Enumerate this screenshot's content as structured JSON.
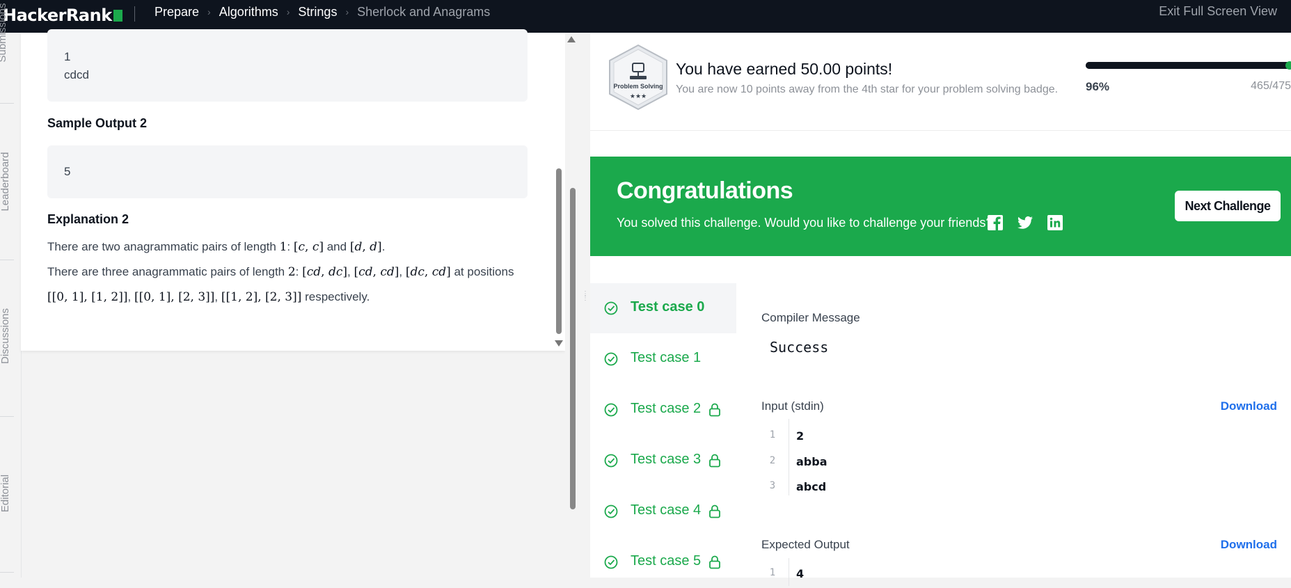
{
  "nav": {
    "logo": "HackerRank",
    "breadcrumbs": [
      "Prepare",
      "Algorithms",
      "Strings",
      "Sherlock and Anagrams"
    ],
    "exit_fullscreen": "Exit Full Screen View"
  },
  "side_tabs": [
    "Submissions",
    "Leaderboard",
    "Discussions",
    "Editorial"
  ],
  "problem": {
    "sample_input_lines": [
      "1",
      "cdcd"
    ],
    "sample_output_heading": "Sample Output 2",
    "sample_output_value": "5",
    "explanation_heading": "Explanation 2",
    "expl_line1_a": "There are two anagrammatic pairs of length ",
    "expl_line1_b": " and ",
    "expl_line1_c": ".",
    "expl_line2_a": "There are three anagrammatic pairs of length ",
    "expl_line2_b": " at positions",
    "expl_line3_b": " respectively."
  },
  "earned": {
    "badge_label": "Problem Solving",
    "title": "You have earned 50.00 points!",
    "subtitle": "You are now 10 points away from the 4th star for your problem solving badge.",
    "progress_percent": "96%",
    "progress_value": 0.96,
    "progress_count": "465/475"
  },
  "congrats": {
    "title": "Congratulations",
    "subtitle": "You solved this challenge. Would you like to challenge your friends?",
    "next_button": "Next Challenge"
  },
  "test_cases": [
    {
      "label": "Test case 0",
      "locked": false
    },
    {
      "label": "Test case 1",
      "locked": false
    },
    {
      "label": "Test case 2",
      "locked": true
    },
    {
      "label": "Test case 3",
      "locked": true
    },
    {
      "label": "Test case 4",
      "locked": true
    },
    {
      "label": "Test case 5",
      "locked": true
    }
  ],
  "output": {
    "compiler_message_label": "Compiler Message",
    "compiler_message": "Success",
    "input_label": "Input (stdin)",
    "download_label": "Download",
    "input_lines": [
      {
        "n": "1",
        "v": "2"
      },
      {
        "n": "2",
        "v": "abba"
      },
      {
        "n": "3",
        "v": "abcd"
      }
    ],
    "expected_label": "Expected Output",
    "expected_lines": [
      {
        "n": "1",
        "v": "4"
      }
    ]
  },
  "colors": {
    "brand_green": "#1ba94c",
    "nav_bg": "#0e141e",
    "link_blue": "#1f6feb"
  }
}
